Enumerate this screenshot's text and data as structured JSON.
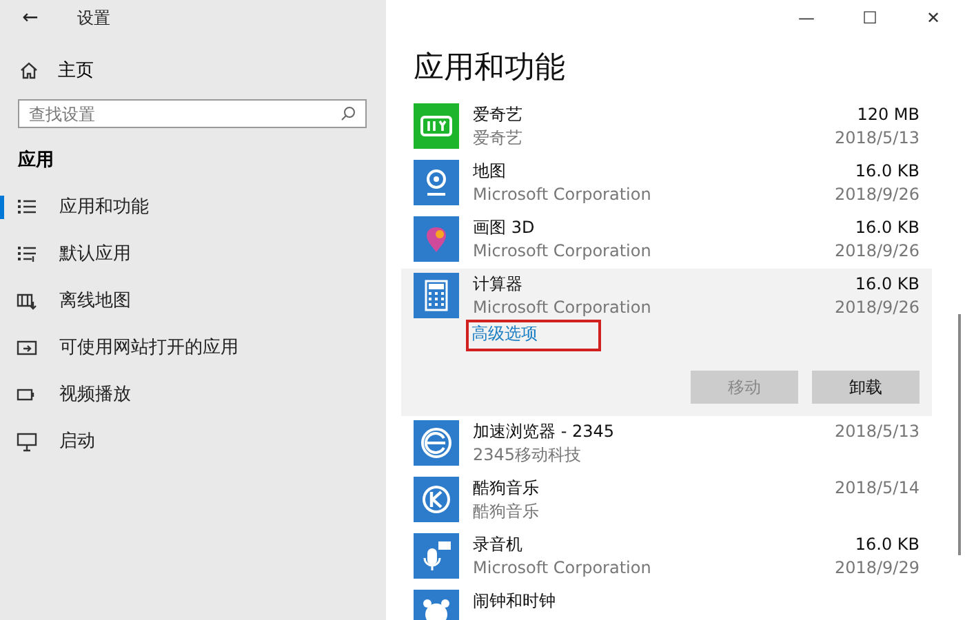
{
  "window": {
    "title": "设置",
    "back": "←",
    "controls": [
      "—",
      "☐",
      "✕"
    ]
  },
  "sidebar": {
    "home": "主页",
    "search": {
      "placeholder": "查找设置"
    },
    "section": "应用",
    "items": [
      {
        "label": "应用和功能",
        "kind": "list",
        "selected": true
      },
      {
        "label": "默认应用",
        "kind": "defaults",
        "selected": false
      },
      {
        "label": "离线地图",
        "kind": "maps",
        "selected": false
      },
      {
        "label": "可使用网站打开的应用",
        "kind": "web",
        "selected": false
      },
      {
        "label": "视频播放",
        "kind": "video",
        "selected": false
      },
      {
        "label": "启动",
        "kind": "startup",
        "selected": false
      }
    ]
  },
  "main": {
    "heading": "应用和功能",
    "apps": [
      {
        "name": "爱奇艺",
        "publisher": "爱奇艺",
        "size": "120 MB",
        "date": "2018/5/13",
        "kind": "video",
        "expanded": false
      },
      {
        "name": "地图",
        "publisher": "Microsoft Corporation",
        "size": "16.0 KB",
        "date": "2018/9/26",
        "kind": "map",
        "expanded": false
      },
      {
        "name": "画图 3D",
        "publisher": "Microsoft Corporation",
        "size": "16.0 KB",
        "date": "2018/9/26",
        "kind": "paint",
        "expanded": false
      },
      {
        "name": "计算器",
        "publisher": "Microsoft Corporation",
        "size": "16.0 KB",
        "date": "2018/9/26",
        "kind": "calculator",
        "expanded": true,
        "link": {
          "label": "高级选项",
          "highlighted": true
        },
        "buttons": [
          {
            "label": "移动",
            "disabled": true
          },
          {
            "label": "卸载",
            "disabled": false
          }
        ]
      },
      {
        "name": "加速浏览器 - 2345",
        "publisher": "2345移动科技",
        "date": "2018/5/13",
        "kind": "browser",
        "expanded": false
      },
      {
        "name": "酷狗音乐",
        "publisher": "酷狗音乐",
        "date": "2018/5/14",
        "kind": "music",
        "expanded": false
      },
      {
        "name": "录音机",
        "publisher": "Microsoft Corporation",
        "size": "16.0 KB",
        "date": "2018/9/29",
        "kind": "recorder",
        "expanded": false
      },
      {
        "name": "闹钟和时钟",
        "kind": "clock",
        "expanded": false
      }
    ]
  }
}
